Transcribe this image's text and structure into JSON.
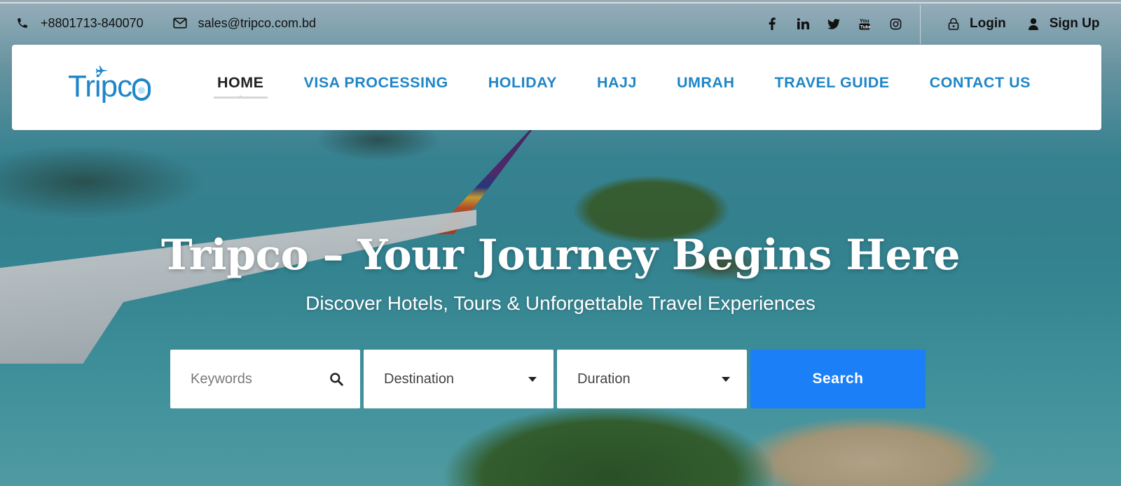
{
  "topbar": {
    "phone": "+8801713-840070",
    "email": "sales@tripco.com.bd",
    "socials": [
      "facebook-icon",
      "linkedin-icon",
      "twitter-icon",
      "youtube-icon",
      "instagram-icon"
    ],
    "login_label": "Login",
    "signup_label": "Sign Up"
  },
  "logo": {
    "text": "Tripc"
  },
  "nav": {
    "items": [
      {
        "label": "HOME",
        "active": true
      },
      {
        "label": "VISA PROCESSING"
      },
      {
        "label": "HOLIDAY"
      },
      {
        "label": "HAJJ"
      },
      {
        "label": "UMRAH"
      },
      {
        "label": "TRAVEL GUIDE"
      },
      {
        "label": "CONTACT US"
      }
    ]
  },
  "hero": {
    "title": "Tripco – Your Journey Begins Here",
    "subtitle": "Discover Hotels, Tours & Unforgettable Travel Experiences"
  },
  "search": {
    "keywords_placeholder": "Keywords",
    "destination_value": "Destination",
    "duration_value": "Duration",
    "button_label": "Search"
  },
  "colors": {
    "brand_blue": "#1f86c7",
    "search_button": "#1b7ff8",
    "nav_active": "#222222"
  }
}
